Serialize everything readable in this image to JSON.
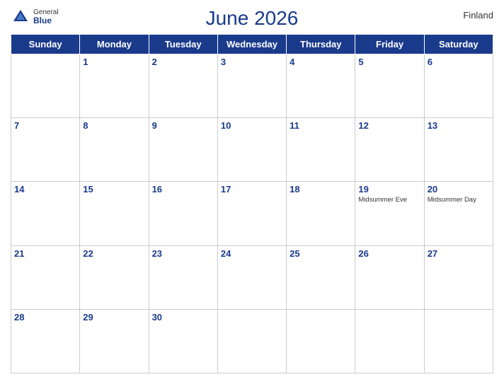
{
  "header": {
    "title": "June 2026",
    "country": "Finland",
    "logo_general": "General",
    "logo_blue": "Blue"
  },
  "weekdays": [
    "Sunday",
    "Monday",
    "Tuesday",
    "Wednesday",
    "Thursday",
    "Friday",
    "Saturday"
  ],
  "weeks": [
    [
      {
        "day": "",
        "events": []
      },
      {
        "day": "1",
        "events": []
      },
      {
        "day": "2",
        "events": []
      },
      {
        "day": "3",
        "events": []
      },
      {
        "day": "4",
        "events": []
      },
      {
        "day": "5",
        "events": []
      },
      {
        "day": "6",
        "events": []
      }
    ],
    [
      {
        "day": "7",
        "events": []
      },
      {
        "day": "8",
        "events": []
      },
      {
        "day": "9",
        "events": []
      },
      {
        "day": "10",
        "events": []
      },
      {
        "day": "11",
        "events": []
      },
      {
        "day": "12",
        "events": []
      },
      {
        "day": "13",
        "events": []
      }
    ],
    [
      {
        "day": "14",
        "events": []
      },
      {
        "day": "15",
        "events": []
      },
      {
        "day": "16",
        "events": []
      },
      {
        "day": "17",
        "events": []
      },
      {
        "day": "18",
        "events": []
      },
      {
        "day": "19",
        "events": [
          "Midsummer Eve"
        ]
      },
      {
        "day": "20",
        "events": [
          "Midsummer Day"
        ]
      }
    ],
    [
      {
        "day": "21",
        "events": []
      },
      {
        "day": "22",
        "events": []
      },
      {
        "day": "23",
        "events": []
      },
      {
        "day": "24",
        "events": []
      },
      {
        "day": "25",
        "events": []
      },
      {
        "day": "26",
        "events": []
      },
      {
        "day": "27",
        "events": []
      }
    ],
    [
      {
        "day": "28",
        "events": []
      },
      {
        "day": "29",
        "events": []
      },
      {
        "day": "30",
        "events": []
      },
      {
        "day": "",
        "events": []
      },
      {
        "day": "",
        "events": []
      },
      {
        "day": "",
        "events": []
      },
      {
        "day": "",
        "events": []
      }
    ]
  ]
}
